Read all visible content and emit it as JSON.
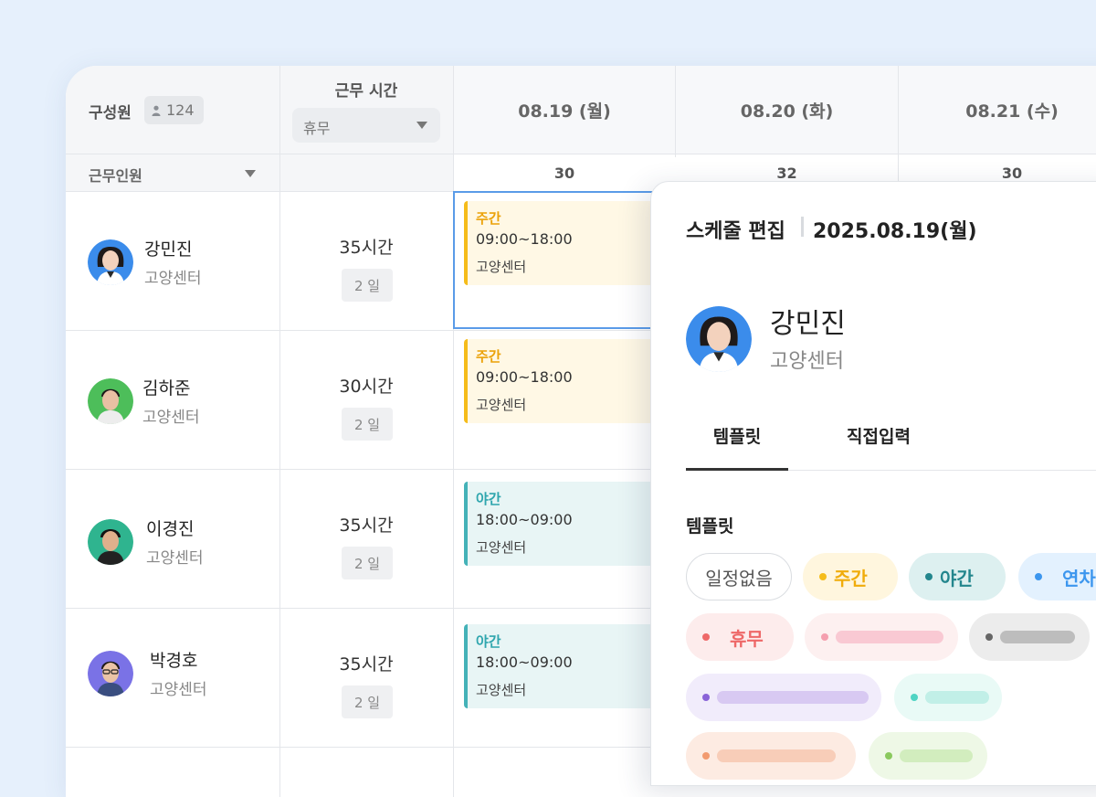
{
  "header": {
    "members_label": "구성원",
    "members_count": "124",
    "hours_label": "근무 시간",
    "hours_filter_value": "휴무",
    "dates": [
      "08.19 (월)",
      "08.20 (화)",
      "08.21 (수)"
    ],
    "filter_label": "근무인원",
    "date_counts": [
      "30",
      "32",
      "30"
    ]
  },
  "rows": [
    {
      "name": "강민진",
      "dept": "고양센터",
      "hours": "35시간",
      "days": "2 일",
      "shift": {
        "type": "주간",
        "time": "09:00~18:00",
        "place": "고양센터"
      }
    },
    {
      "name": "김하준",
      "dept": "고양센터",
      "hours": "30시간",
      "days": "2 일",
      "shift": {
        "type": "주간",
        "time": "09:00~18:00",
        "place": "고양센터"
      }
    },
    {
      "name": "이경진",
      "dept": "고양센터",
      "hours": "35시간",
      "days": "2 일",
      "shift": {
        "type": "야간",
        "time": "18:00~09:00",
        "place": "고양센터"
      }
    },
    {
      "name": "박경호",
      "dept": "고양센터",
      "hours": "35시간",
      "days": "2 일",
      "shift": {
        "type": "야간",
        "time": "18:00~09:00",
        "place": "고양센터"
      }
    }
  ],
  "panel": {
    "title": "스케줄 편집",
    "date": "2025.08.19(월)",
    "person_name": "강민진",
    "person_dept": "고양센터",
    "tabs": [
      "템플릿",
      "직접입력"
    ],
    "section_label": "템플릿",
    "chips": [
      "일정없음",
      "주간",
      "야간",
      "연차",
      "휴무"
    ]
  },
  "colors": {
    "day_accent": "#F5BC1A",
    "night_accent": "#44B2B8",
    "selection": "#5A9BE8",
    "background": "#E6F0FC"
  },
  "icons": [
    "person-icon",
    "caret-down-icon",
    "avatar"
  ]
}
